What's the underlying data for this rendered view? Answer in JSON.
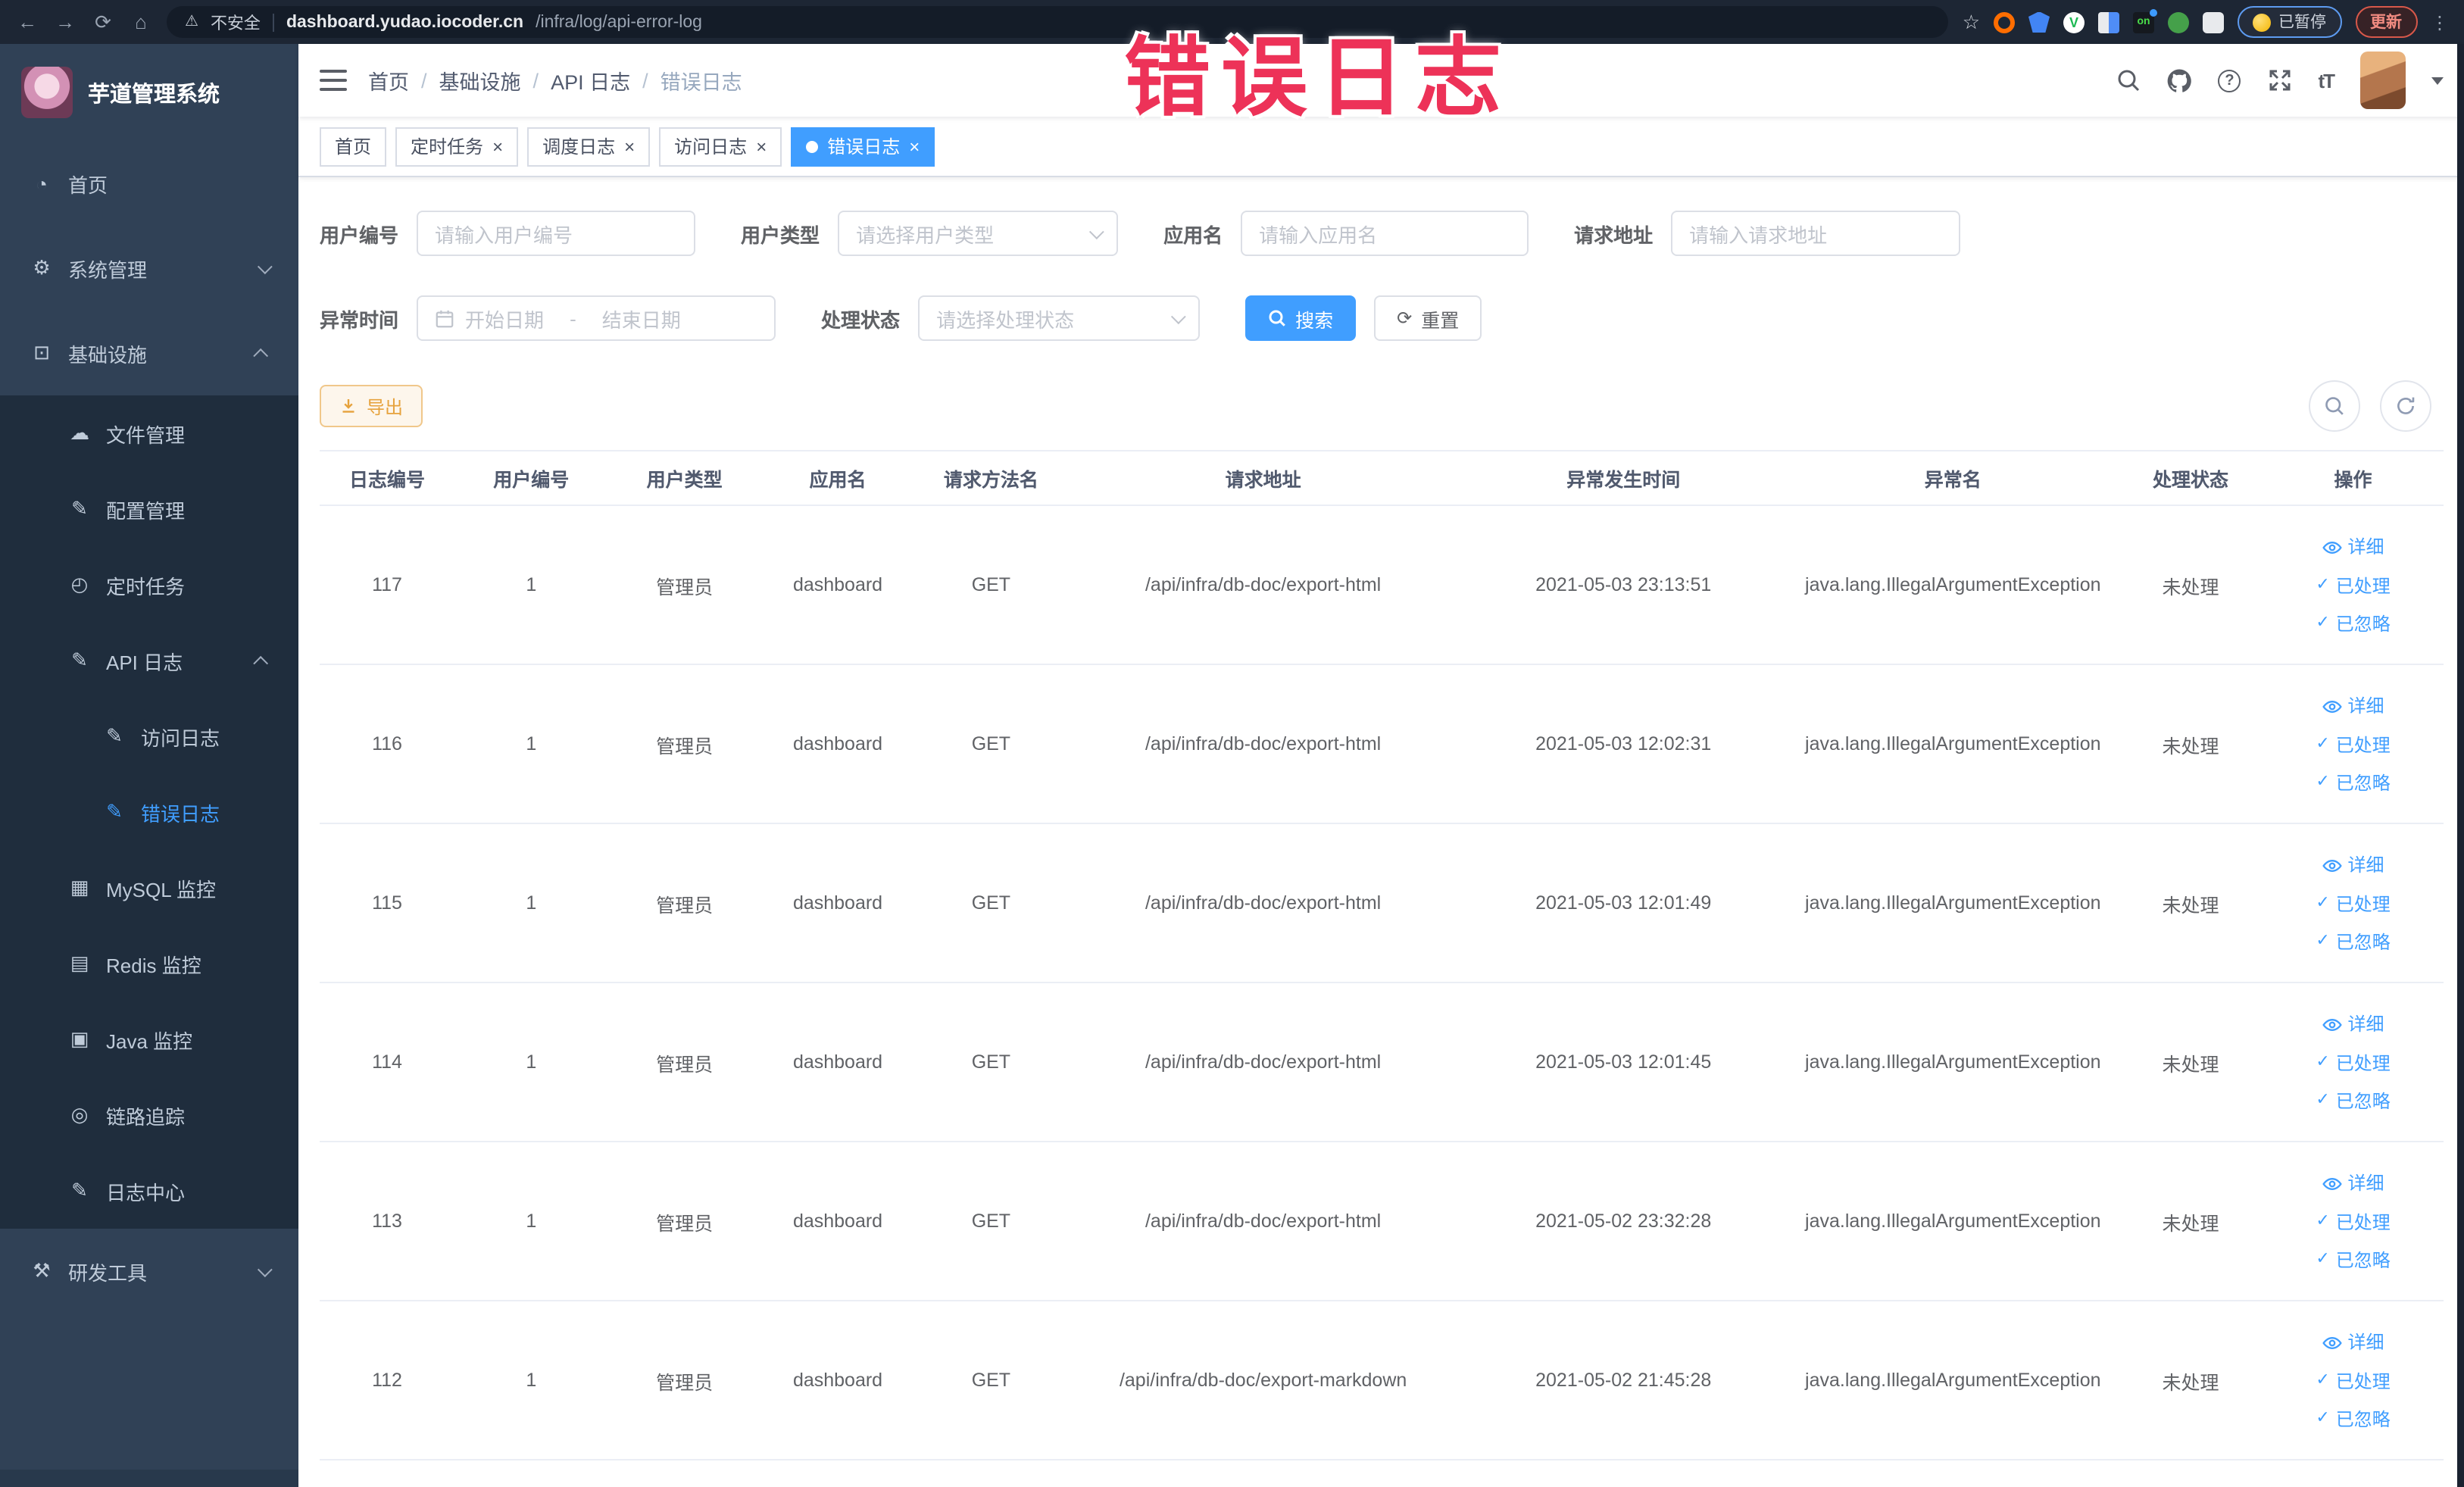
{
  "browser": {
    "security_label": "不安全",
    "url_host": "dashboard.yudao.iocoder.cn",
    "url_path": "/infra/log/api-error-log",
    "paused_badge": "已暂停",
    "update_badge": "更新",
    "extensions": [
      {
        "name": "extension-orange-ring-icon",
        "kind": "ring",
        "glyph": ""
      },
      {
        "name": "extension-blue-shield-icon",
        "kind": "shield",
        "glyph": ""
      },
      {
        "name": "extension-green-v-icon",
        "kind": "greenv",
        "glyph": "V"
      },
      {
        "name": "extension-grid-icon",
        "kind": "grid",
        "glyph": ""
      },
      {
        "name": "extension-on-badge-icon",
        "kind": "onbadge",
        "glyph": "on"
      },
      {
        "name": "extension-sprout-icon",
        "kind": "sprout",
        "glyph": ""
      },
      {
        "name": "extension-puzzle-icon",
        "kind": "puzzle",
        "glyph": ""
      }
    ]
  },
  "overlay_title": "错误日志",
  "sidebar": {
    "app_title": "芋道管理系统",
    "items": [
      {
        "label": "首页",
        "icon": "dashboard-icon",
        "glyph": "◔",
        "level": 1
      },
      {
        "label": "系统管理",
        "icon": "gear-icon",
        "glyph": "⚙",
        "level": 1,
        "chevron": "down"
      },
      {
        "label": "基础设施",
        "icon": "monitor-icon",
        "glyph": "⊡",
        "level": 1,
        "chevron": "up"
      },
      {
        "label": "文件管理",
        "icon": "cloud-upload-icon",
        "glyph": "☁",
        "level": 2
      },
      {
        "label": "配置管理",
        "icon": "edit-square-icon",
        "glyph": "✎",
        "level": 2
      },
      {
        "label": "定时任务",
        "icon": "clock-icon",
        "glyph": "◴",
        "level": 2
      },
      {
        "label": "API 日志",
        "icon": "log-edit-icon",
        "glyph": "✎",
        "level": 2,
        "chevron": "up"
      },
      {
        "label": "访问日志",
        "icon": "log-edit-icon",
        "glyph": "✎",
        "level": 3
      },
      {
        "label": "错误日志",
        "icon": "log-edit-icon",
        "glyph": "✎",
        "level": 3,
        "active": true
      },
      {
        "label": "MySQL 监控",
        "icon": "mysql-monitor-icon",
        "glyph": "▦",
        "level": 2
      },
      {
        "label": "Redis 监控",
        "icon": "redis-monitor-icon",
        "glyph": "▤",
        "level": 2
      },
      {
        "label": "Java 监控",
        "icon": "java-monitor-icon",
        "glyph": "▣",
        "level": 2
      },
      {
        "label": "链路追踪",
        "icon": "trace-icon",
        "glyph": "◎",
        "level": 2
      },
      {
        "label": "日志中心",
        "icon": "log-center-icon",
        "glyph": "✎",
        "level": 2
      },
      {
        "label": "研发工具",
        "icon": "tools-icon",
        "glyph": "⚒",
        "level": 1,
        "chevron": "down"
      }
    ]
  },
  "breadcrumb": {
    "items": [
      "首页",
      "基础设施",
      "API 日志",
      "错误日志"
    ]
  },
  "tabs": [
    {
      "label": "首页",
      "closable": false,
      "active": false
    },
    {
      "label": "定时任务",
      "closable": true,
      "active": false
    },
    {
      "label": "调度日志",
      "closable": true,
      "active": false
    },
    {
      "label": "访问日志",
      "closable": true,
      "active": false
    },
    {
      "label": "错误日志",
      "closable": true,
      "active": true
    }
  ],
  "filters": {
    "row1": [
      {
        "label": "用户编号",
        "type": "input",
        "placeholder": "请输入用户编号",
        "width": 184
      },
      {
        "label": "用户类型",
        "type": "select",
        "placeholder": "请选择用户类型",
        "width": 185
      },
      {
        "label": "应用名",
        "type": "input",
        "placeholder": "请输入应用名",
        "width": 190
      },
      {
        "label": "请求地址",
        "type": "input",
        "placeholder": "请输入请求地址",
        "width": 191
      }
    ],
    "time_label": "异常时间",
    "time_start_placeholder": "开始日期",
    "time_separator": "-",
    "time_end_placeholder": "结束日期",
    "status_label": "处理状态",
    "status_placeholder": "请选择处理状态",
    "search_button": "搜索",
    "reset_button": "重置"
  },
  "toolbar": {
    "export_button": "导出"
  },
  "table": {
    "headers": [
      "日志编号",
      "用户编号",
      "用户类型",
      "应用名",
      "请求方法名",
      "请求地址",
      "异常发生时间",
      "异常名",
      "处理状态",
      "操作"
    ],
    "column_keys": [
      "id",
      "user_id",
      "user_type",
      "app",
      "method",
      "url",
      "time",
      "exception",
      "status"
    ],
    "rows": [
      {
        "id": "117",
        "user_id": "1",
        "user_type": "管理员",
        "app": "dashboard",
        "method": "GET",
        "url": "/api/infra/db-doc/export-html",
        "time": "2021-05-03 23:13:51",
        "exception": "java.lang.IllegalArgumentException",
        "status": "未处理"
      },
      {
        "id": "116",
        "user_id": "1",
        "user_type": "管理员",
        "app": "dashboard",
        "method": "GET",
        "url": "/api/infra/db-doc/export-html",
        "time": "2021-05-03 12:02:31",
        "exception": "java.lang.IllegalArgumentException",
        "status": "未处理"
      },
      {
        "id": "115",
        "user_id": "1",
        "user_type": "管理员",
        "app": "dashboard",
        "method": "GET",
        "url": "/api/infra/db-doc/export-html",
        "time": "2021-05-03 12:01:49",
        "exception": "java.lang.IllegalArgumentException",
        "status": "未处理"
      },
      {
        "id": "114",
        "user_id": "1",
        "user_type": "管理员",
        "app": "dashboard",
        "method": "GET",
        "url": "/api/infra/db-doc/export-html",
        "time": "2021-05-03 12:01:45",
        "exception": "java.lang.IllegalArgumentException",
        "status": "未处理"
      },
      {
        "id": "113",
        "user_id": "1",
        "user_type": "管理员",
        "app": "dashboard",
        "method": "GET",
        "url": "/api/infra/db-doc/export-html",
        "time": "2021-05-02 23:32:28",
        "exception": "java.lang.IllegalArgumentException",
        "status": "未处理"
      },
      {
        "id": "112",
        "user_id": "1",
        "user_type": "管理员",
        "app": "dashboard",
        "method": "GET",
        "url": "/api/infra/db-doc/export-markdown",
        "time": "2021-05-02 21:45:28",
        "exception": "java.lang.IllegalArgumentException",
        "status": "未处理"
      }
    ],
    "row_actions": [
      {
        "label": "详细",
        "icon": "eye"
      },
      {
        "label": "已处理",
        "icon": "check"
      },
      {
        "label": "已忽略",
        "icon": "check"
      }
    ]
  },
  "colors": {
    "accent": "#409eff",
    "sidebar_bg": "#304156",
    "submenu_bg": "#1f2d3d",
    "chrome_bg": "#1d2634",
    "warning": "#e6a23c",
    "overlay_red": "#ed3258"
  }
}
